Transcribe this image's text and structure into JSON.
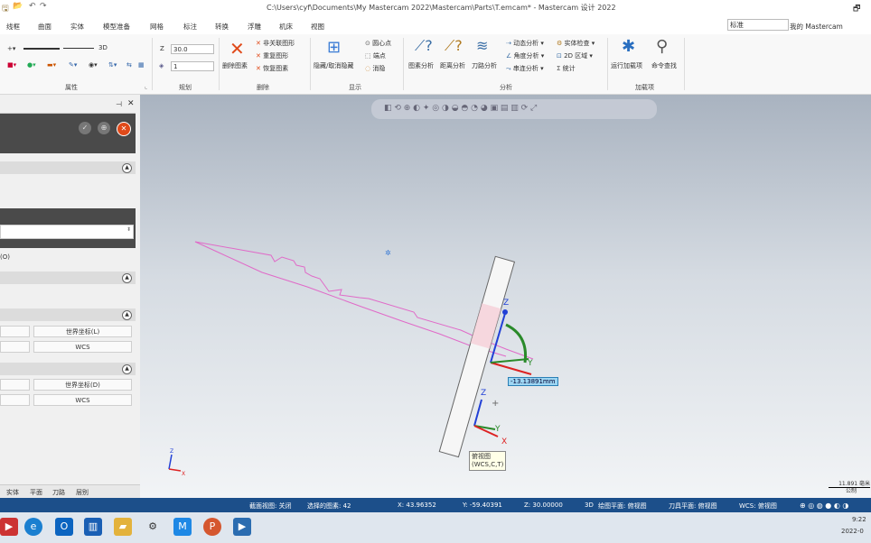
{
  "window": {
    "title": "C:\\Users\\cyf\\Documents\\My Mastercam 2022\\Mastercam\\Parts\\T.emcam* - Mastercam 设计 2022"
  },
  "menu": [
    "线框",
    "曲面",
    "实体",
    "模型准备",
    "网格",
    "标注",
    "转换",
    "浮雕",
    "机床",
    "视图"
  ],
  "ribbon_right": {
    "style_select": "标准",
    "my_mastercam": "我的 Mastercam"
  },
  "ribbon": {
    "attributes": {
      "label": "属性",
      "mode_3d": "3D"
    },
    "plan": {
      "label": "规划",
      "z_label": "Z",
      "z_value": "30.0",
      "level_value": "1"
    },
    "delete": {
      "label": "删除",
      "delete_entity": "删除图素",
      "unassoc": "非关联图形",
      "dup": "重复图形",
      "restore": "恢复图素"
    },
    "display": {
      "label": "显示",
      "hide": "隐藏/取消隐藏",
      "center": "圆心点",
      "end": "端点",
      "blank": "消隐"
    },
    "analysis": {
      "label": "分析",
      "entity": "图素分析",
      "distance": "距离分析",
      "toolpath": "刀路分析",
      "dynamic": "动态分析",
      "angle": "角度分析",
      "chain": "串连分析",
      "solid_check": "实体检查",
      "area_2d": "2D 区域",
      "stats": "统计"
    },
    "addins": {
      "label": "加载项",
      "run": "运行加载项",
      "cmd_find": "命令查找"
    }
  },
  "panel": {
    "btn_world1": "世界坐标(L)",
    "btn_wcs1": "WCS",
    "btn_world2": "世界坐标(D)",
    "btn_wcs2": "WCS",
    "option_o": "(O)",
    "tabs": [
      "实体",
      "平面",
      "刀路",
      "层别"
    ]
  },
  "viewport": {
    "dimension": "-13.13891mm",
    "view_label_1": "俯视图",
    "view_label_2": "(WCS,C,T)",
    "scale": "11.891 毫米",
    "scale_unit": "公制"
  },
  "status": {
    "section": "截面视图: 关闭",
    "selected": "选择的图素: 42",
    "x": "X: 43.96352",
    "y": "Y: -59.40391",
    "z": "Z: 30.00000",
    "mode": "3D",
    "cplane": "绘图平面: 俯视图",
    "tplane": "刀具平面: 俯视图",
    "wcs": "WCS: 俯视图"
  },
  "taskbar": {
    "time": "9:22",
    "date": "2022-0"
  },
  "colors": {
    "status": "#1c4f8a",
    "accent_red": "#e04a1a"
  }
}
